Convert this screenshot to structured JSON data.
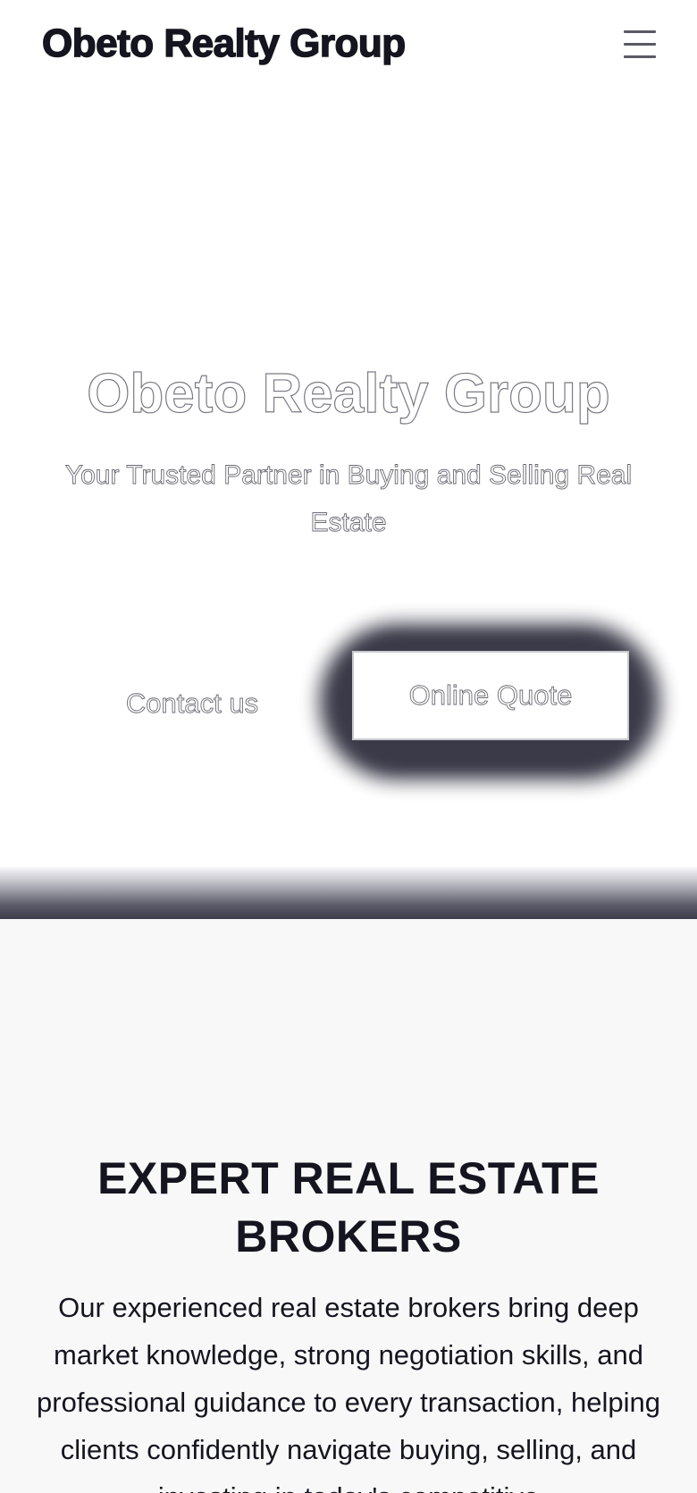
{
  "header": {
    "brand": "Obeto Realty Group",
    "menu_icon": "hamburger-menu-icon"
  },
  "hero": {
    "title": "Obeto Realty Group",
    "subtitle": "Your Trusted Partner in Buying and Selling Real Estate",
    "contact_label": "Contact us",
    "quote_label": "Online Quote"
  },
  "section": {
    "title": "EXPERT REAL ESTATE BROKERS",
    "body": "Our experienced real estate brokers bring deep market knowledge, strong negotiation skills, and professional guidance to every transaction, helping clients confidently navigate buying, selling, and investing in today's competitive"
  },
  "colors": {
    "text": "#15151f",
    "band_dark": "#3c3c4a",
    "section_bg": "#f8f8f8"
  }
}
